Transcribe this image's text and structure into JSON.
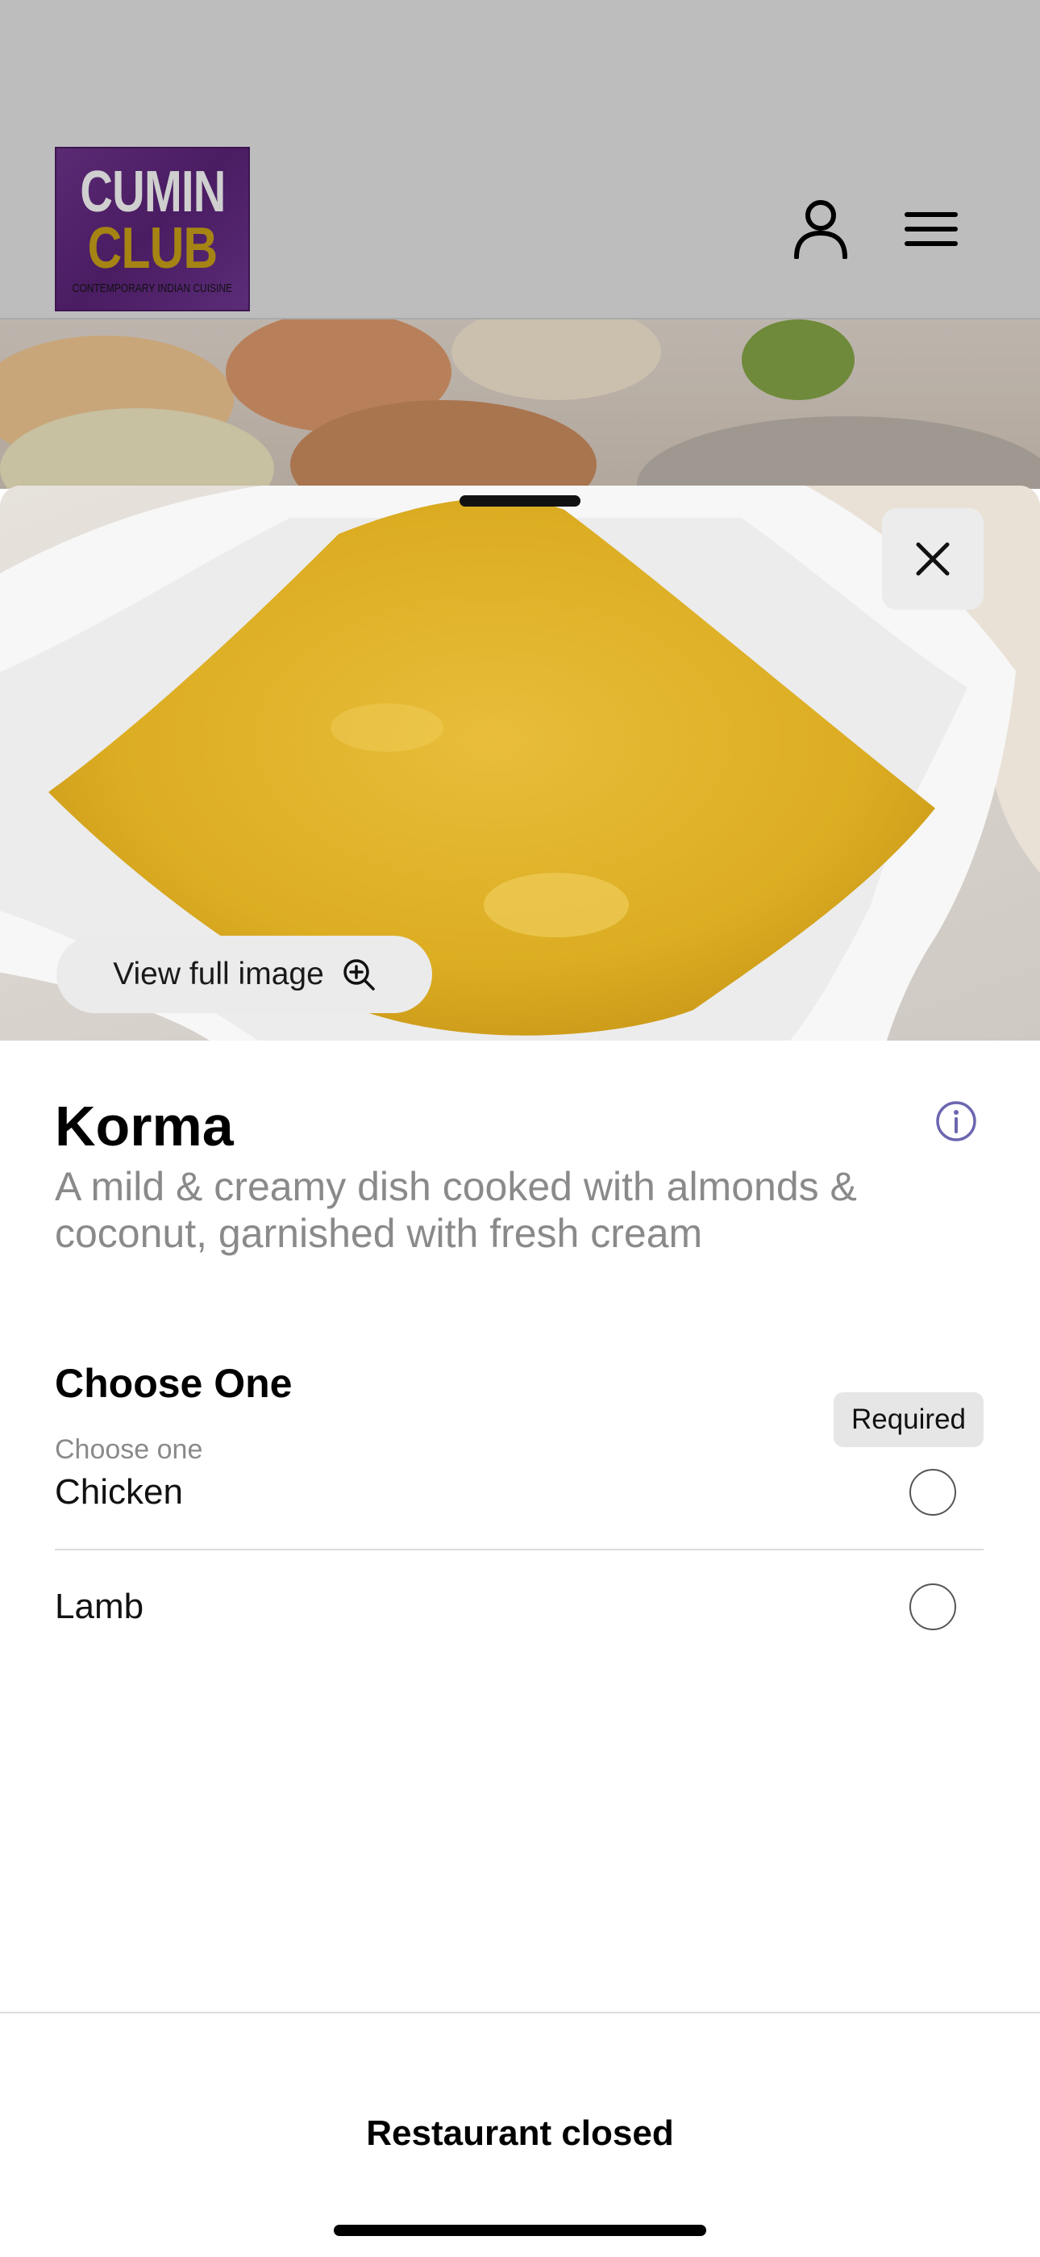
{
  "header": {
    "logo": {
      "line1": "CUMIN",
      "line2": "CLUB",
      "tagline": "CONTEMPORARY INDIAN CUISINE"
    },
    "account_icon": "person-icon",
    "menu_icon": "hamburger-menu-icon"
  },
  "item": {
    "view_full_image_label": "View full image",
    "title": "Korma",
    "description": "A mild & creamy dish cooked with almonds & coconut, garnished with fresh cream"
  },
  "option_group": {
    "title": "Choose One",
    "subtitle": "Choose one",
    "badge": "Required",
    "options": [
      {
        "label": "Chicken",
        "selected": false
      },
      {
        "label": "Lamb",
        "selected": false
      }
    ]
  },
  "footer": {
    "status": "Restaurant closed"
  },
  "colors": {
    "overlay_gray": "#bdbdbd",
    "logo_purple": "#4a1c62",
    "logo_gold": "#a58414",
    "info_icon": "#6b66b0",
    "muted_text": "#8a8a8a"
  }
}
